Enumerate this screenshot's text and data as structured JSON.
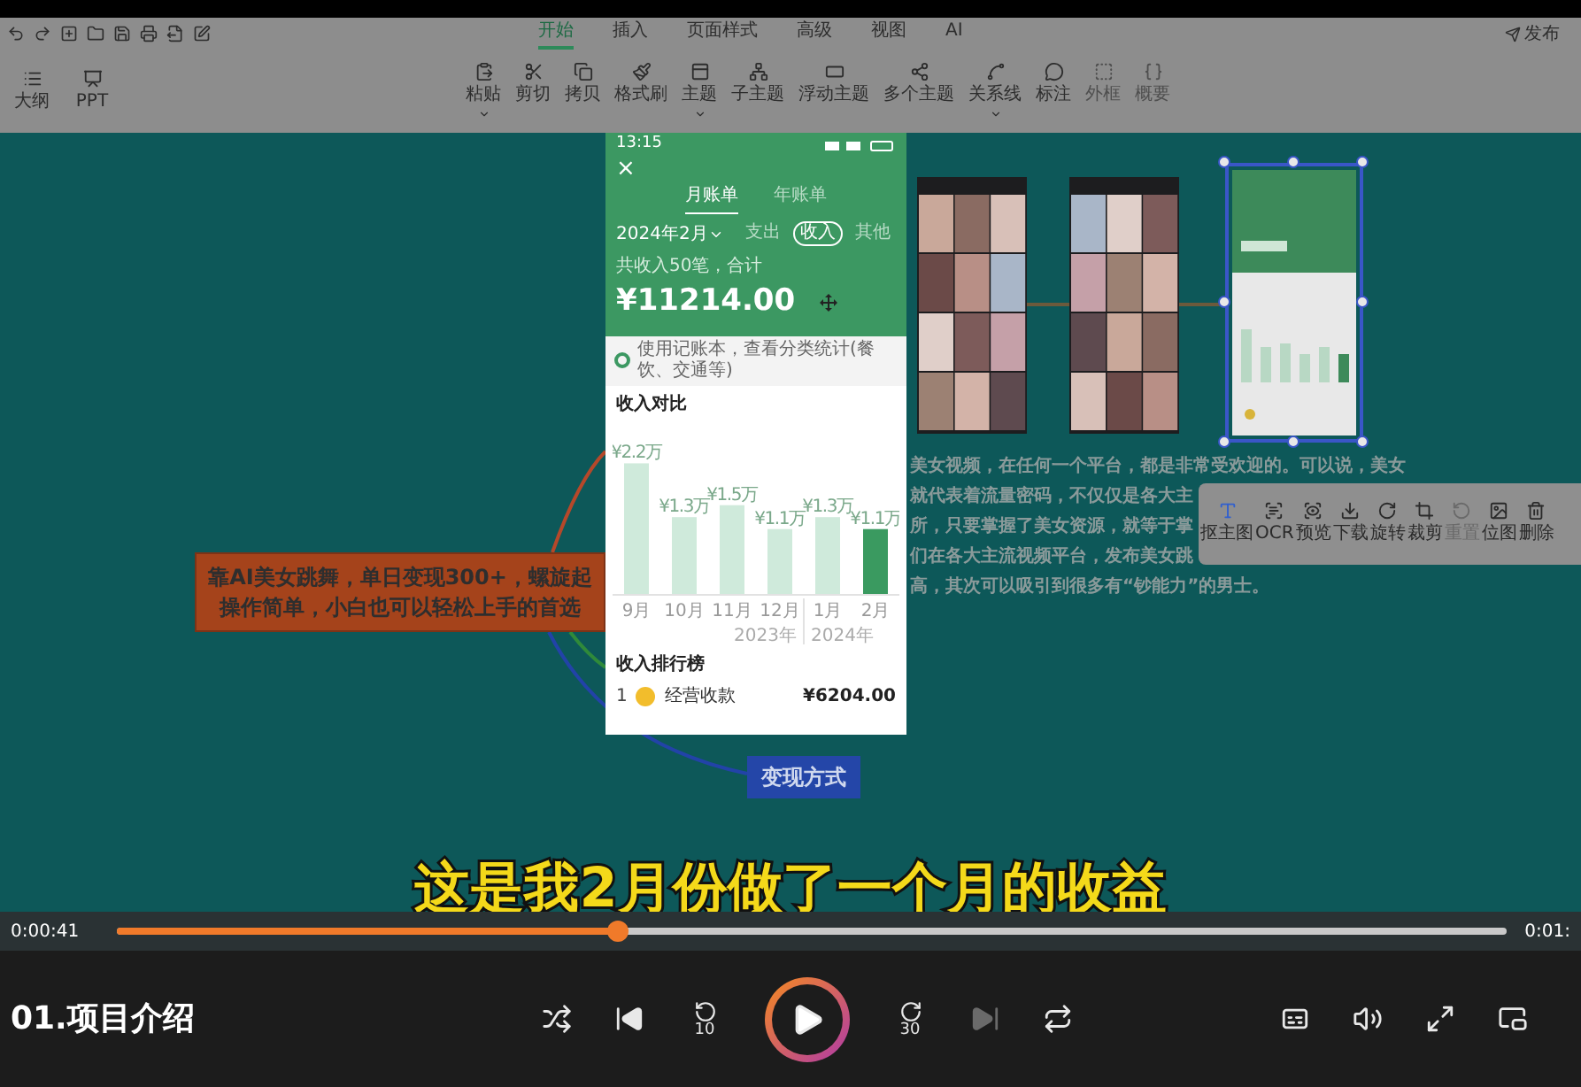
{
  "toolbar": {
    "menu_tabs": [
      {
        "label": "开始",
        "selected": true
      },
      {
        "label": "插入",
        "selected": false
      },
      {
        "label": "页面样式",
        "selected": false
      },
      {
        "label": "高级",
        "selected": false
      },
      {
        "label": "视图",
        "selected": false
      },
      {
        "label": "AI",
        "selected": false
      }
    ],
    "publish": "发布",
    "side_tools": [
      "大纲",
      "PPT"
    ],
    "tools": [
      {
        "label": "粘贴",
        "menu": true,
        "disabled": false
      },
      {
        "label": "剪切",
        "menu": false,
        "disabled": false
      },
      {
        "label": "拷贝",
        "menu": false,
        "disabled": false
      },
      {
        "label": "格式刷",
        "menu": false,
        "disabled": false
      },
      {
        "label": "主题",
        "menu": true,
        "disabled": false
      },
      {
        "label": "子主题",
        "menu": false,
        "disabled": false
      },
      {
        "label": "浮动主题",
        "menu": false,
        "disabled": false
      },
      {
        "label": "多个主题",
        "menu": false,
        "disabled": false
      },
      {
        "label": "关系线",
        "menu": true,
        "disabled": false
      },
      {
        "label": "标注",
        "menu": false,
        "disabled": false
      },
      {
        "label": "外框",
        "menu": false,
        "disabled": true
      },
      {
        "label": "概要",
        "menu": false,
        "disabled": true
      }
    ]
  },
  "canvas": {
    "orange_node": [
      "靠AI美女跳舞，单日变现300+，螺旋起",
      "操作简单，小白也可以轻松上手的首选"
    ],
    "blue_node": "变现方式",
    "phone": {
      "time": "13:15",
      "close": "×",
      "tabs": [
        {
          "label": "月账单",
          "selected": true
        },
        {
          "label": "年账单",
          "selected": false
        }
      ],
      "month": "2024年2月",
      "filters": [
        {
          "label": "支出",
          "selected": false
        },
        {
          "label": "收入",
          "selected": true
        },
        {
          "label": "其他",
          "selected": false
        }
      ],
      "summary": "共收入50笔，合计",
      "amount": "¥11214.00",
      "banner": "使用记账本，查看分类统计(餐饮、交通等)",
      "chart_title": "收入对比",
      "chart_data": {
        "type": "bar",
        "categories": [
          "9月",
          "10月",
          "11月",
          "12月",
          "1月",
          "2月"
        ],
        "values": [
          2.2,
          1.3,
          1.5,
          1.1,
          1.3,
          1.1
        ],
        "value_labels": [
          "¥2.2万",
          "¥1.3万",
          "¥1.5万",
          "¥1.1万",
          "¥1.3万",
          "¥1.1万"
        ],
        "colors": [
          "#cfeadb",
          "#cfeadb",
          "#cfeadb",
          "#cfeadb",
          "#cfeadb",
          "#3a9a60"
        ]
      },
      "year_labels": [
        "2023年",
        "2024年"
      ],
      "ranking_title": "收入排行榜",
      "ranking": [
        {
          "rank": "1",
          "name": "经营收款",
          "amount": "¥6204.00"
        }
      ]
    },
    "paragraph_lines": [
      "美女视频，在任何一个平台，都是非常受欢迎的。可以说，美女",
      "就代表着流量密码，不仅仅是各大主",
      "所，只要掌握了美女资源，就等于掌",
      "们在各大主流视频平台，发布美女跳",
      "高，其次可以吸引到很多有“钞能力”的男士。"
    ],
    "image_tools": [
      {
        "label": "抠主图",
        "disabled": false
      },
      {
        "label": "OCR",
        "disabled": false
      },
      {
        "label": "预览",
        "disabled": false
      },
      {
        "label": "下载",
        "disabled": false
      },
      {
        "label": "旋转",
        "disabled": false
      },
      {
        "label": "裁剪",
        "disabled": false
      },
      {
        "label": "重置",
        "disabled": true
      },
      {
        "label": "位图",
        "disabled": false
      },
      {
        "label": "删除",
        "disabled": false
      }
    ]
  },
  "subtitle": "这是我2月份做了一个月的收益",
  "player": {
    "elapsed": "0:00:41",
    "total": "0:01:",
    "level": 0.36,
    "title": "01.项目介绍",
    "rewind": "10",
    "forward": "30",
    "next_disabled": true
  }
}
